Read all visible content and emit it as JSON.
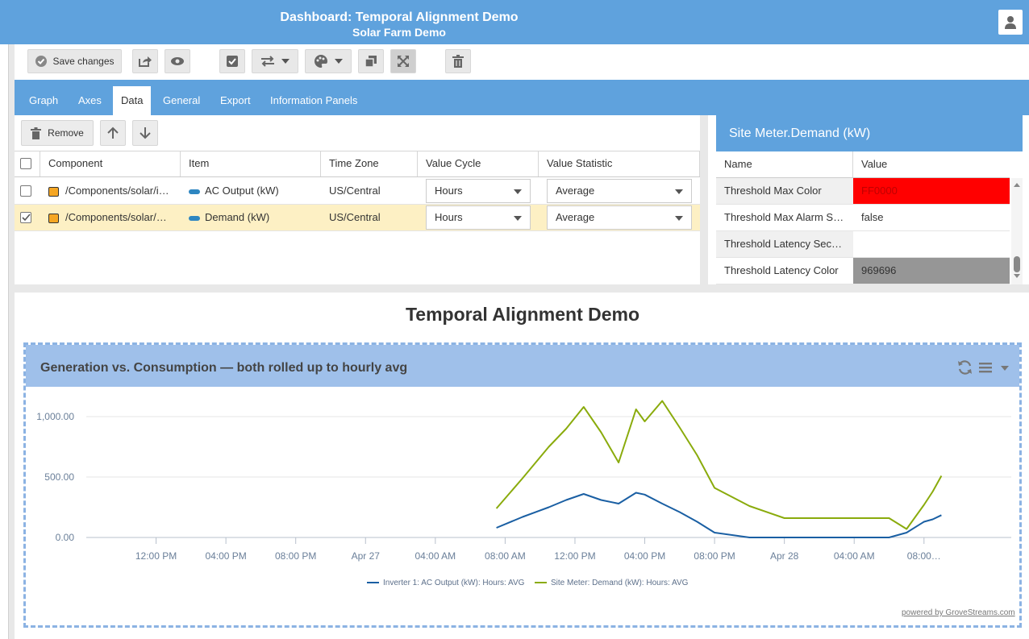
{
  "header": {
    "title": "Dashboard: Temporal Alignment Demo",
    "subtitle": "Solar Farm Demo"
  },
  "toolbar": {
    "save_label": "Save changes"
  },
  "tabs": [
    {
      "label": "Graph"
    },
    {
      "label": "Axes"
    },
    {
      "label": "Data"
    },
    {
      "label": "General"
    },
    {
      "label": "Export"
    },
    {
      "label": "Information Panels"
    }
  ],
  "grid": {
    "remove_label": "Remove",
    "columns": [
      "Component",
      "Item",
      "Time Zone",
      "Value Cycle",
      "Value Statistic"
    ],
    "rows": [
      {
        "component": "/Components/solar/i…",
        "item": "AC Output (kW)",
        "time_zone": "US/Central",
        "value_cycle": "Hours",
        "value_statistic": "Average",
        "selected": false
      },
      {
        "component": "/Components/solar/…",
        "item": "Demand (kW)",
        "time_zone": "US/Central",
        "value_cycle": "Hours",
        "value_statistic": "Average",
        "selected": true
      }
    ]
  },
  "properties": {
    "title": "Site Meter.Demand (kW)",
    "name_header": "Name",
    "value_header": "Value",
    "rows": [
      {
        "name": "Threshold Max Color",
        "value": "FF0000",
        "swatch": "#ff0000"
      },
      {
        "name": "Threshold Max Alarm S…",
        "value": "false",
        "swatch": ""
      },
      {
        "name": "Threshold Latency Sec…",
        "value": "",
        "swatch": ""
      },
      {
        "name": "Threshold Latency Color",
        "value": "969696",
        "swatch": "#969696"
      }
    ]
  },
  "dashboard_title": "Temporal Alignment Demo",
  "widget": {
    "title": "Generation vs. Consumption — both rolled up to hourly avg",
    "powered_by": "powered by GroveStreams.com"
  },
  "chart_data": {
    "type": "line",
    "xlim": [
      0,
      53
    ],
    "ylim": [
      0,
      1000
    ],
    "y_ticks": [
      0,
      500,
      1000
    ],
    "y_tick_labels": [
      "0.00",
      "500.00",
      "1,000.00"
    ],
    "x_ticks": [
      4,
      8,
      12,
      16,
      20,
      24,
      28,
      32,
      36,
      40,
      44,
      48
    ],
    "x_tick_labels": [
      "12:00 PM",
      "04:00 PM",
      "08:00 PM",
      "Apr 27",
      "04:00 AM",
      "08:00 AM",
      "12:00 PM",
      "04:00 PM",
      "08:00 PM",
      "Apr 28",
      "04:00 AM",
      "08:00…"
    ],
    "legend_position": "bottom",
    "series": [
      {
        "name": "Inverter 1: AC Output (kW): Hours: AVG",
        "color": "#1a5fa3",
        "x": [
          23.5,
          25,
          26.5,
          27.5,
          28.5,
          29.5,
          30.5,
          31.5,
          32,
          33,
          34,
          35,
          36,
          38,
          40,
          42,
          44,
          45,
          46,
          47,
          48,
          48.5,
          49
        ],
        "y": [
          80,
          170,
          250,
          310,
          360,
          310,
          280,
          370,
          355,
          280,
          210,
          130,
          40,
          0,
          0,
          0,
          0,
          0,
          0,
          40,
          130,
          150,
          185
        ]
      },
      {
        "name": "Site Meter: Demand (kW): Hours: AVG",
        "color": "#8aab0c",
        "x": [
          23.5,
          25,
          26.5,
          27.5,
          28.5,
          29.5,
          30.5,
          31.5,
          32,
          33,
          34,
          35,
          36,
          38,
          40,
          42,
          44,
          45,
          46,
          47,
          48,
          48.5,
          49
        ],
        "y": [
          240,
          490,
          750,
          900,
          1080,
          870,
          620,
          1060,
          960,
          1130,
          910,
          680,
          410,
          260,
          160,
          160,
          160,
          160,
          160,
          70,
          270,
          380,
          510
        ]
      }
    ]
  }
}
